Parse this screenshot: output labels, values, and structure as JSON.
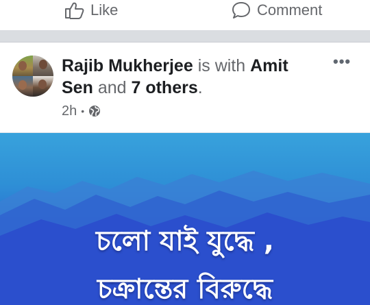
{
  "actions": {
    "like_label": "Like",
    "comment_label": "Comment"
  },
  "post": {
    "author": "Rajib Mukherjee",
    "connector": "is with",
    "tagged_first": "Amit Sen",
    "and_text": "and",
    "others_text": "7 others",
    "period": ".",
    "time": "2h",
    "separator_dot": "•",
    "privacy_icon": "globe-icon",
    "more_icon": "more-options-icon"
  },
  "image": {
    "line1": "চলো যাই যুদ্ধে ,",
    "line2": "চক্রান্তের বিরুদ্ধে"
  },
  "colors": {
    "secondary_text": "#65676b",
    "primary_text": "#1c1e21",
    "separator": "#dadde1",
    "image_blue": "#2a6fd2"
  }
}
